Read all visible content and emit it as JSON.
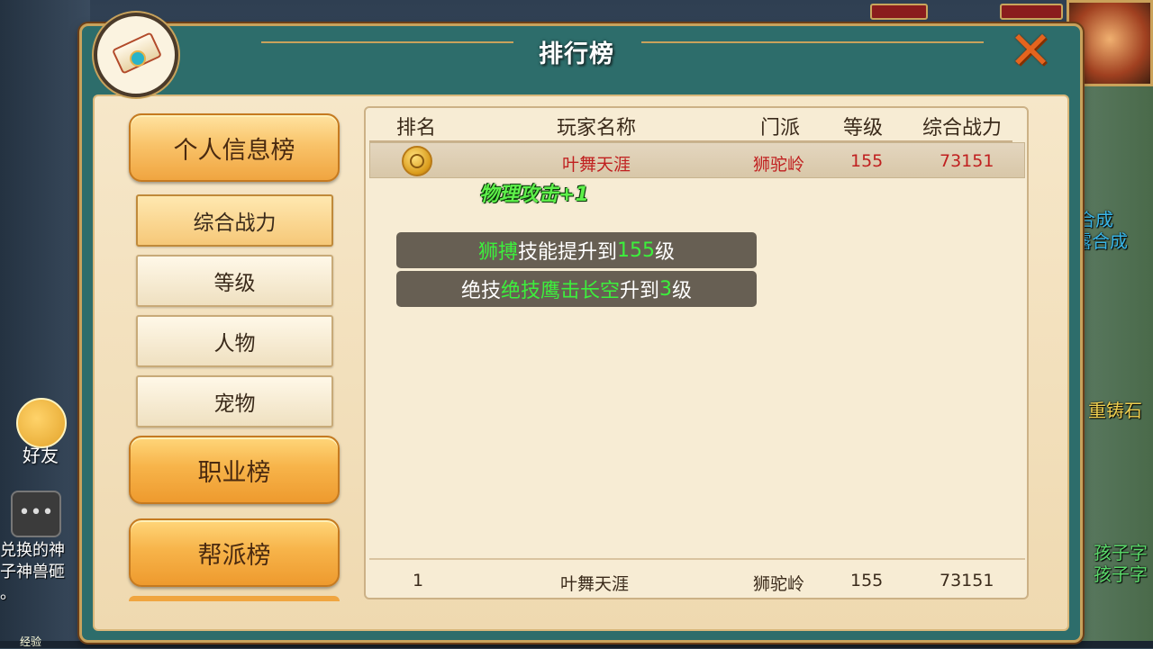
{
  "panel": {
    "title": "排行榜"
  },
  "menu": {
    "main_tabs": [
      "个人信息榜",
      "职业榜",
      "帮派榜"
    ],
    "sub_tabs": [
      "综合战力",
      "等级",
      "人物",
      "宠物"
    ]
  },
  "table": {
    "headers": [
      "排名",
      "玩家名称",
      "门派",
      "等级",
      "综合战力"
    ],
    "highlight_row": {
      "name": "叶舞天涯",
      "school": "狮驼岭",
      "level": "155",
      "power": "73151"
    },
    "my_row": {
      "rank": "1",
      "name": "叶舞天涯",
      "school": "狮驼岭",
      "level": "155",
      "power": "73151"
    }
  },
  "floating_text": "物理攻击+1",
  "notices": [
    {
      "p1": "狮搏",
      "p2": "技能提升到",
      "p3": "155",
      "p4": "级"
    },
    {
      "p1": "绝技",
      "p2": "绝技鹰击长空",
      "p3": "升到",
      "p4": "3",
      "p5": "级"
    }
  ],
  "background": {
    "friend_label": "好友",
    "chat_lines": [
      "兑换的神",
      "子神兽砸",
      "。"
    ],
    "right_texts": [
      "合成",
      "露合成",
      "重铸石",
      "孩子字",
      "孩子字"
    ],
    "exp_label": "经验"
  },
  "colors": {
    "accent_orange": "#f7b44a",
    "panel_teal": "#2d6d6b",
    "rank_red": "#c02020",
    "notice_green": "#3cf03c"
  }
}
